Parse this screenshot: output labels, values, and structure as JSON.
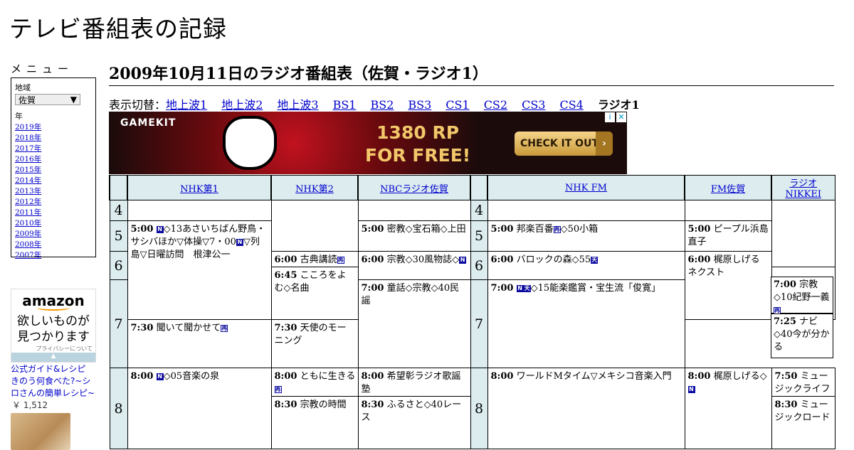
{
  "site": {
    "title": "テレビ番組表の記録"
  },
  "sidebar": {
    "menu_title": "メニュー",
    "region_label": "地域",
    "region_value": "佐賀",
    "year_label": "年",
    "years": [
      "2019年",
      "2018年",
      "2017年",
      "2016年",
      "2015年",
      "2014年",
      "2013年",
      "2012年",
      "2011年",
      "2010年",
      "2009年",
      "2008年",
      "2007年"
    ]
  },
  "amazon_ad": {
    "logo": "amazon",
    "message_line1": "欲しいものが",
    "message_line2": "見つかります",
    "privacy": "プライバシーについて"
  },
  "product": {
    "title": "公式ガイド&レシピ きのう何食べた?~シロさんの簡単レシピ~",
    "price": "￥ 1,512"
  },
  "page": {
    "heading": "2009年10月11日のラジオ番組表（佐賀・ラジオ1）"
  },
  "switcher": {
    "label": "表示切替：",
    "links": [
      "地上波1",
      "地上波2",
      "地上波3",
      "BS1",
      "BS2",
      "BS3",
      "CS1",
      "CS2",
      "CS3",
      "CS4"
    ],
    "current": "ラジオ1"
  },
  "banner_ad": {
    "brand": "GAMEKIT",
    "line1": "1380 RP",
    "line2": "FOR FREE!",
    "cta": "CHECK IT OUT",
    "chevron": "›",
    "info": "i",
    "close": "✕"
  },
  "channels": [
    "NHK第1",
    "NHK第2",
    "NBCラジオ佐賀",
    "NHK FM",
    "FM佐賀",
    "ラジオNIKKEI"
  ],
  "hours": [
    "4",
    "5",
    "6",
    "7",
    "8"
  ],
  "programs": {
    "nhk1_500_time": "5:00",
    "nhk1_500_title": "◇13あさいちばん野鳥・サシバほか▽体操▽7・00",
    "nhk1_500_title2": "▽列島▽日曜訪問　根津公一",
    "nhk1_800_time": "8:00",
    "nhk1_800_title": "◇05音楽の泉",
    "nhk2_600_time": "6:00",
    "nhk2_600_title": "古典講読",
    "nhk2_645_time": "6:45",
    "nhk2_645_title": "こころをよむ◇名曲",
    "nhk2_730_time": "7:30",
    "nhk2_730_title": "聞いて聞かせて",
    "nhk2_800_time": "8:00",
    "nhk2_800_title": "ともに生きる",
    "nhk2_830_time": "8:30",
    "nhk2_830_title": "宗教の時間",
    "nbc_500_time": "5:00",
    "nbc_500_title": "密教◇宝石箱◇上田",
    "nbc_600_time": "6:00",
    "nbc_600_title": "宗教◇30風物誌◇",
    "nbc_700_time": "7:00",
    "nbc_700_title": "童話◇宗教◇40民謡",
    "nbc_800_time": "8:00",
    "nbc_800_title": "希望彰ラジオ歌謡塾",
    "nbc_830_time": "8:30",
    "nbc_830_title": "ふるさと◇40レース",
    "fm_500_time": "5:00",
    "fm_500_title": "邦楽百番",
    "fm_500_title2": "◇50小箱",
    "fm_600_time": "6:00",
    "fm_600_title": "バロックの森◇55",
    "fm_700_time": "7:00",
    "fm_700_title": "◇15能楽鑑賞・宝生流「俊寛」",
    "fm_800_time": "8:00",
    "fm_800_title": "ワールドMタイム▽メキシコ音楽入門",
    "fms_500_time": "5:00",
    "fms_500_title": "ピープル浜島直子",
    "fms_600_time": "6:00",
    "fms_600_title": "梶原しげるネクスト",
    "fms_730_time": "7:30",
    "fms_730_title": "天使のモーニング",
    "fms_800_time": "8:00",
    "fms_800_title": "梶原しげる◇",
    "nk_700_time": "7:00",
    "nk_700_title": "宗教◇10紀野一義",
    "nk_725_time": "7:25",
    "nk_725_title": "ナビ◇40今が分かる",
    "nk_750_time": "7:50",
    "nk_750_title": "ミュージックライフ",
    "nk_830_time": "8:30",
    "nk_830_title": "ミュージックロード"
  },
  "icons": {
    "news": "N",
    "stereo": "再",
    "weather": "天"
  }
}
